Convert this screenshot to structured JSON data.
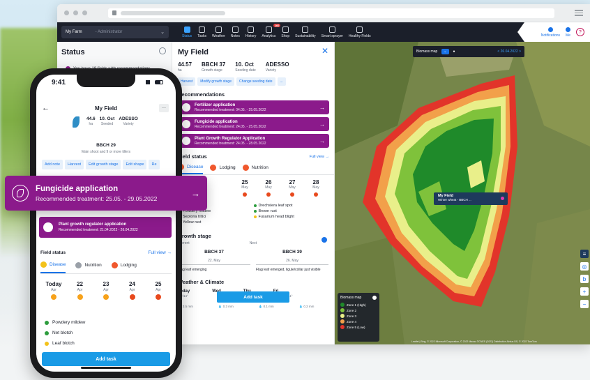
{
  "colors": {
    "purple": "#8b1a8b",
    "blue": "#1a73e8",
    "nav": "#1b1f2a",
    "orange": "#f0582d"
  },
  "appbar": {
    "farm": "My Farm",
    "role": "- Administrator",
    "nav": [
      {
        "label": "Status",
        "icon": "status-icon",
        "active": true
      },
      {
        "label": "Tasks",
        "icon": "tasks-icon"
      },
      {
        "label": "Weather",
        "icon": "weather-icon"
      },
      {
        "label": "Notes",
        "icon": "notes-icon"
      },
      {
        "label": "History",
        "icon": "history-icon"
      },
      {
        "label": "Analytics",
        "icon": "analytics-icon",
        "badge": "160"
      },
      {
        "label": "Shop",
        "icon": "shop-icon"
      },
      {
        "label": "Sustainability",
        "icon": "sustainability-icon"
      },
      {
        "label": "Smart sprayer",
        "icon": "sprayer-icon"
      },
      {
        "label": "Healthy Fields",
        "icon": "healthy-fields-icon"
      }
    ],
    "notifications": "Notifications",
    "me": "Me"
  },
  "status_panel": {
    "title": "Status",
    "note": "You have 18 fields with recommendations"
  },
  "field_panel": {
    "title": "My Field",
    "stats": [
      {
        "value": "44.57",
        "label": "ha"
      },
      {
        "value": "BBCH 37",
        "label": "Growth stage"
      },
      {
        "value": "10. Oct",
        "label": "Seeding date"
      },
      {
        "value": "ADESSO",
        "label": "Variety"
      }
    ],
    "chips": [
      "Harvest",
      "Modify growth stage",
      "Change seeding date",
      "..."
    ],
    "recommendations_title": "Recommendations",
    "recommendations": [
      {
        "title": "Fertilizer application",
        "sub": "Recommended treatment: 04.05. - 25.05.2022"
      },
      {
        "title": "Fungicide application",
        "sub": "Recommended treatment: 24.05. - 25.05.2022"
      },
      {
        "title": "Plant Growth Regulator Application",
        "sub": "Recommended treatment: 24.05. - 28.05.2022"
      }
    ],
    "field_status": "Field status",
    "full_view": "Full view →",
    "tabs": [
      "Disease",
      "Lodging",
      "Nutrition"
    ],
    "days": [
      {
        "d": "25",
        "m": "May"
      },
      {
        "d": "26",
        "m": "May"
      },
      {
        "d": "27",
        "m": "May"
      },
      {
        "d": "28",
        "m": "May"
      }
    ],
    "diseases_left": [
      "Eyespot",
      "Powdery mildew",
      "Septoria tritici",
      "Yellow rust"
    ],
    "diseases_right": [
      "Drechslera leaf spot",
      "Brown rust",
      "Fusarium head blight"
    ],
    "growth_stage": {
      "title": "Growth stage",
      "current_label": "Current",
      "next_label": "Next",
      "current": "BBCH 37",
      "current_date": "22. May",
      "current_desc": "Flag leaf emerging",
      "next": "BBCH 39",
      "next_date": "26. May",
      "next_desc": "Flag leaf emerged, ligule/collar just visible"
    },
    "weather": {
      "title": "Weather & Climate",
      "days": [
        "Today",
        "Wed",
        "Thu",
        "Fri"
      ],
      "temps": [
        "21°/14°",
        "",
        "",
        "17°/11°"
      ],
      "rain": [
        "💧 3.5 mm",
        "💧 0.3 mm",
        "💧 0.1 mm",
        "💧 0.2 mm"
      ]
    },
    "add_task": "Add task"
  },
  "map": {
    "layer": "Biomass map",
    "date": "< 26.04.2022 >",
    "field_name": "My Field",
    "field_sub": "Winter wheat - BBCH ...",
    "legend_title": "Biomass map",
    "zones": [
      {
        "label": "Zone 1 (High)",
        "color": "#1f8a2a"
      },
      {
        "label": "Zone 2",
        "color": "#7fc23b"
      },
      {
        "label": "Zone 3",
        "color": "#e9ef8a"
      },
      {
        "label": "Zone 4",
        "color": "#f2a04a"
      },
      {
        "label": "Zone 5 (Low)",
        "color": "#e2342a"
      }
    ],
    "attribution": "Leaflet | Bing, © 2022 Microsoft Corporation, © 2022 Maxar, ©CNES (2022) Distribution Airbus DS, © 2022 TomTom"
  },
  "phone": {
    "time": "9:41",
    "title": "My Field",
    "stats": [
      {
        "value": "44.6",
        "label": "ha"
      },
      {
        "value": "10. Oct",
        "label": "Seeded"
      },
      {
        "value": "ADESSO",
        "label": "Variety"
      }
    ],
    "bbch": "BBCH 29",
    "bbch_sub": "Main shoot and 9 or more tillers",
    "chips": [
      "Add note",
      "Harvest",
      "Edit growth stage",
      "Edit shape",
      "Re"
    ],
    "rec": {
      "title": "Plant growth regulator application",
      "sub": "Recommended treatment: 21.04.2022 - 26.04.2022"
    },
    "field_status": "Field status",
    "full_view": "Full view →",
    "tabs": [
      "Disease",
      "Nutrition",
      "Lodging"
    ],
    "days": [
      {
        "d": "Today",
        "m": "Apr"
      },
      {
        "d": "22",
        "m": "Apr"
      },
      {
        "d": "23",
        "m": "Apr"
      },
      {
        "d": "24",
        "m": "Apr"
      },
      {
        "d": "25",
        "m": "Apr"
      }
    ],
    "diseases": [
      "Powdery mildew",
      "Net blotch",
      "Leaf blotch"
    ],
    "add_task": "Add task"
  },
  "fungicide_card": {
    "title": "Fungicide application",
    "sub": "Recommended treatment: 25.05. - 29.05.2022"
  }
}
